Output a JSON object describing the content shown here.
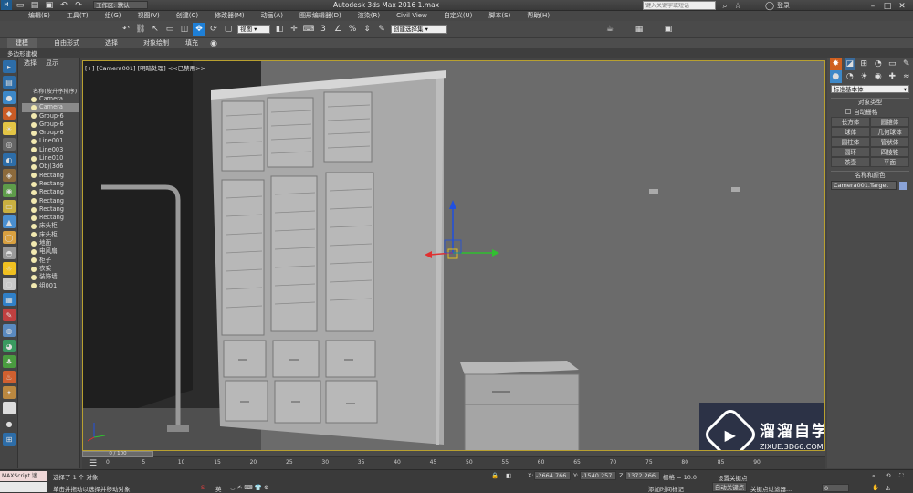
{
  "app": {
    "title": "Autodesk 3ds Max 2016   1.max",
    "workspace": "工作区: 默认",
    "search_placeholder": "键入关键字或短语",
    "login": "登录"
  },
  "menus": [
    "编辑(E)",
    "工具(T)",
    "组(G)",
    "视图(V)",
    "创建(C)",
    "修改器(M)",
    "动画(A)",
    "图形编辑器(D)",
    "渲染(R)",
    "Civil View",
    "自定义(U)",
    "脚本(S)",
    "帮助(H)"
  ],
  "toolbar": {
    "view_dropdown": "视图",
    "selection_set": "创建选择集"
  },
  "ribbon": {
    "tabs": [
      "建模",
      "自由形式",
      "选择",
      "对象绘制",
      "填充"
    ],
    "sub": "多边形建模"
  },
  "scene": {
    "tabs": [
      "选择",
      "显示"
    ],
    "header": "名称(按升序排序)",
    "items": [
      "Camera",
      "Camera",
      "Group-6",
      "Group-6",
      "Group-6",
      "Line001",
      "Line003",
      "Line010",
      "Obj(3d6",
      "Rectang",
      "Rectang",
      "Rectang",
      "Rectang",
      "Rectang",
      "Rectang",
      "床头柜",
      "床头柜",
      "地面",
      "电风扇",
      "柜子",
      "衣架",
      "装饰墙",
      "组001"
    ]
  },
  "viewport": {
    "label": "[+] [Camera001] [明暗处理] <<已禁用>>"
  },
  "command_panel": {
    "category": "标准基本体",
    "rollout_object_type": "对象类型",
    "autogrid": "自动栅格",
    "objects": [
      "长方体",
      "圆锥体",
      "球体",
      "几何球体",
      "圆柱体",
      "管状体",
      "圆环",
      "四棱锥",
      "茶壶",
      "平面"
    ],
    "rollout_name_color": "名称和颜色",
    "name_value": "Camera001.Target",
    "name_color": "#8aa3d8"
  },
  "timeline": {
    "counter": "0 / 100",
    "ticks": [
      "0",
      "5",
      "10",
      "15",
      "20",
      "25",
      "30",
      "35",
      "40",
      "45",
      "50",
      "55",
      "60",
      "65",
      "70",
      "75",
      "80",
      "85",
      "90"
    ]
  },
  "status": {
    "maxscript": "MAXScript 迷",
    "selected": "选择了 1 个 对象",
    "hint": "单击并拖动以选择并移动对象",
    "x_label": "X:",
    "x": "-2664.766",
    "y_label": "Y:",
    "y": "-1540.257",
    "z_label": "Z:",
    "z": "1372.266",
    "grid": "栅格 = 10.0",
    "add_tag": "添加时间标记",
    "auto_key": "自动关键点",
    "set_key": "设置关键点",
    "key_filter": "关键点过滤器...",
    "frame": "0",
    "tray": "英"
  },
  "watermark": {
    "name": "溜溜自学",
    "url": "ZIXUE.3D66.COM"
  },
  "colors": {
    "accent": "#1e7fd6",
    "viewport_bg": "#6b6b6b",
    "frame_border": "#b8a030",
    "watermark_bg": "#2c3246"
  }
}
